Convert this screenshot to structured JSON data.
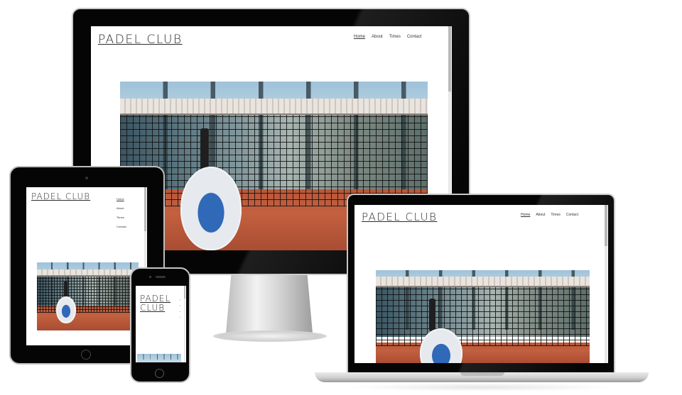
{
  "site": {
    "title": "PADEL CLUB",
    "title_phone_line1": "PADEL",
    "title_phone_line2": "CLUB",
    "nav": [
      "Home",
      "About",
      "Times",
      "Contact"
    ],
    "active_nav": "Home"
  },
  "colors": {
    "bezel": "#050505",
    "court": "#c2603f",
    "racket_blue": "#2f69b8",
    "text": "#2b2b2b"
  },
  "icons": [
    "home-button-icon",
    "camera-icon"
  ]
}
